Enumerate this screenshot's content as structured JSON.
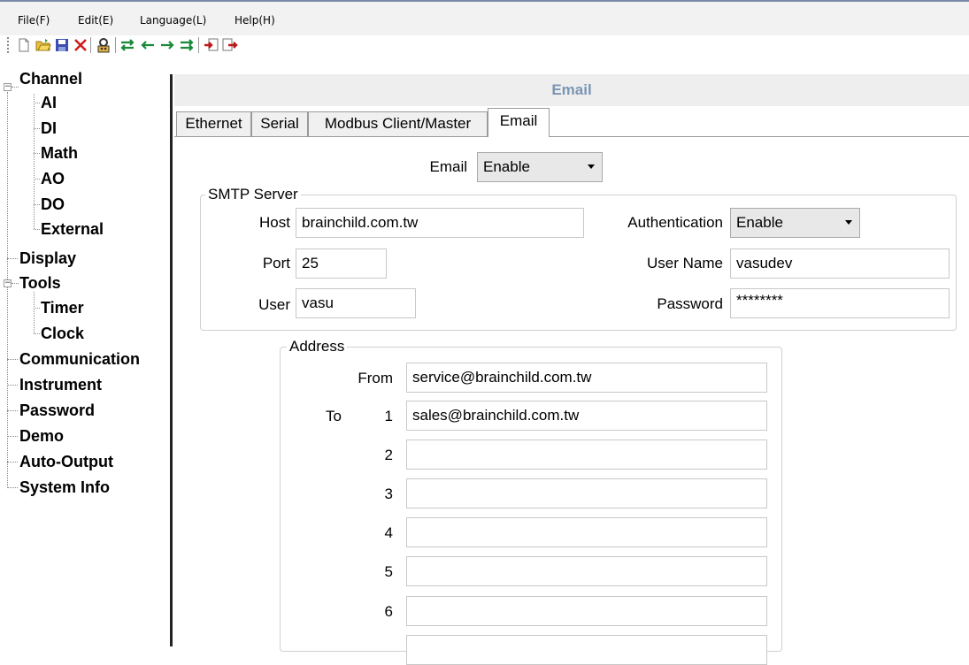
{
  "menu": [
    "File(F)",
    "Edit(E)",
    "Language(L)",
    "Help(H)"
  ],
  "toolbar": {
    "icons": [
      "new-file-icon",
      "open-folder-icon",
      "save-icon",
      "delete-icon",
      "device-search-icon",
      "transfer-both-icon",
      "upload-left-icon",
      "download-right-icon",
      "transfer-both-alt-icon",
      "import-icon",
      "export-icon"
    ]
  },
  "sidebar": {
    "channel": "Channel",
    "channel_children": [
      "AI",
      "DI",
      "Math",
      "AO",
      "DO",
      "External"
    ],
    "display": "Display",
    "tools": "Tools",
    "tools_children": [
      "Timer",
      "Clock"
    ],
    "others": [
      "Communication",
      "Instrument",
      "Password",
      "Demo",
      "Auto-Output",
      "System Info"
    ],
    "expander_open": "−"
  },
  "header": {
    "title": "Email"
  },
  "tabs": [
    "Ethernet",
    "Serial",
    "Modbus Client/Master",
    "Email"
  ],
  "email": {
    "label": "Email",
    "value": "Enable"
  },
  "smtp": {
    "legend": "SMTP Server",
    "host_label": "Host",
    "host": "brainchild.com.tw",
    "port_label": "Port",
    "port": "25",
    "user_label": "User",
    "user": "vasu",
    "auth_label": "Authentication",
    "auth": "Enable",
    "username_label": "User Name",
    "username": "vasudev",
    "password_label": "Password",
    "password": "********"
  },
  "address": {
    "legend": "Address",
    "from_label": "From",
    "from": "service@brainchild.com.tw",
    "to_label": "To",
    "to": [
      {
        "n": "1",
        "value": "sales@brainchild.com.tw"
      },
      {
        "n": "2",
        "value": ""
      },
      {
        "n": "3",
        "value": ""
      },
      {
        "n": "4",
        "value": ""
      },
      {
        "n": "5",
        "value": ""
      },
      {
        "n": "6",
        "value": ""
      }
    ]
  }
}
